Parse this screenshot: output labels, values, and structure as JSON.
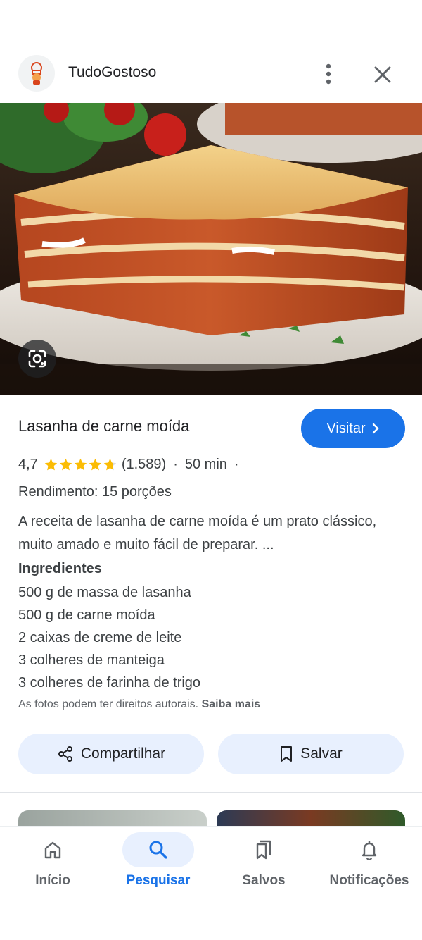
{
  "header": {
    "site_name": "TudoGostoso",
    "logo_icon": "chef-hat-logo",
    "more_icon": "more-vertical-icon",
    "close_icon": "close-icon"
  },
  "hero": {
    "alt_subject": "lasagna-photo",
    "lens_icon": "google-lens-icon"
  },
  "recipe": {
    "title": "Lasanha de carne moída",
    "visit_label": "Visitar",
    "rating": "4,7",
    "stars": 4.7,
    "reviews": "(1.589)",
    "sep1": "·",
    "time": "50 min",
    "sep2": "·",
    "yield": "Rendimento: 15 porções",
    "description": "A receita de lasanha de carne moída é um prato clássico, muito amado e muito fácil de preparar. ...",
    "ingredients_title": "Ingredientes",
    "ingredients": [
      "500 g de massa de lasanha",
      "500 g de carne moída",
      "2 caixas de creme de leite",
      "3 colheres de manteiga",
      "3 colheres de farinha de trigo"
    ],
    "rights_text": "As fotos podem ter direitos autorais.",
    "rights_link": "Saiba mais"
  },
  "actions": {
    "share_label": "Compartilhar",
    "save_label": "Salvar"
  },
  "nav": {
    "items": [
      {
        "label": "Início",
        "icon": "home-icon"
      },
      {
        "label": "Pesquisar",
        "icon": "search-icon",
        "active": true
      },
      {
        "label": "Salvos",
        "icon": "bookmarks-icon"
      },
      {
        "label": "Notificações",
        "icon": "bell-icon"
      }
    ]
  },
  "colors": {
    "accent": "#1a73e8",
    "star": "#fbbc04",
    "chip_bg": "#e8f0fe"
  }
}
